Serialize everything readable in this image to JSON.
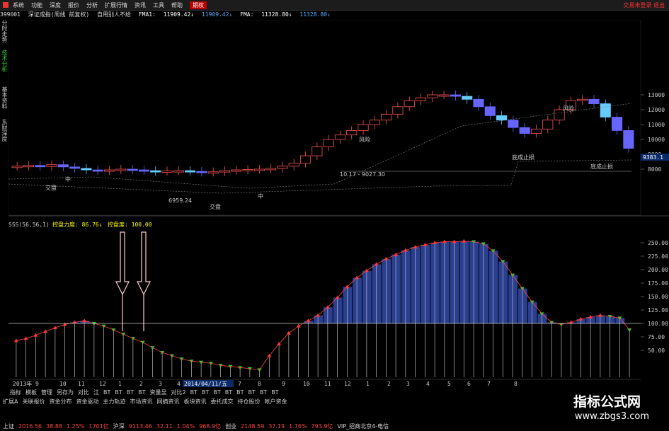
{
  "menu": {
    "items": [
      "系统",
      "功能",
      "深度",
      "报价",
      "分析",
      "扩展行情",
      "资讯",
      "工具",
      "帮助",
      "期权"
    ],
    "active_index": 9,
    "right_text": "交易未登录  退出"
  },
  "infobar": {
    "code": "399001",
    "name": "深证成指(周线 前复权)",
    "user": "自用别人不给",
    "fma1_label": "FMA1:",
    "fma1_value": "11909.42↓",
    "fma1_value2": "11909.42↓",
    "fma_label": "FMA:",
    "fma_value": "11328.80↓",
    "fma_value2": "11328.80↓"
  },
  "side_tabs": [
    "分时走势",
    "技术分析",
    "基本资料",
    "东财深度"
  ],
  "price_panel": {
    "y_ticks": [
      "13000",
      "12000",
      "11000",
      "10000",
      "9000",
      "8000"
    ],
    "current_price": "9383.1",
    "annotations": [
      "交盘",
      "交盘",
      "6959.24",
      "10.17 - 9027.30",
      "风险",
      "底成止损",
      "底成止损",
      "风险",
      "中",
      "中"
    ]
  },
  "indicator": {
    "title": "SSS(56,56,1)",
    "label1": "控盘力度: 86.76↓",
    "label2": "控盘度: 100.00",
    "y_ticks": [
      "250.00",
      "225.00",
      "200.00",
      "175.00",
      "150.00",
      "125.00",
      "100.00",
      "75.00",
      "50.00"
    ]
  },
  "x_axis": {
    "labels": [
      "2013年",
      "9",
      "10",
      "11",
      "12",
      "1",
      "2",
      "3",
      "4",
      "2014/04/11/五",
      "7",
      "8",
      "9",
      "10",
      "11",
      "12",
      "1",
      "2",
      "3",
      "4",
      "5",
      "6",
      "7",
      "8"
    ]
  },
  "toolbar": {
    "row1": [
      "指标",
      "模板",
      "管理",
      "另存为",
      "对比",
      "江",
      "BT",
      "BT",
      "BT",
      "BT",
      "资量显",
      "对比2",
      "BT",
      "BT",
      "BT",
      "BT",
      "BT",
      "BT",
      "BT",
      "BT"
    ],
    "row2": [
      "扩展A",
      "关联报价",
      "资金分布",
      "资金驱动",
      "主力轨迹",
      "市场资讯",
      "网摘资讯",
      "板块资讯",
      "委托成交",
      "持仓股份",
      "帐户资金"
    ],
    "status": [
      "上证",
      "2016.56",
      "38.88",
      "1.25%",
      "1701亿",
      "沪深",
      "9113.46",
      "32.11",
      "1.04%",
      "968.9亿",
      "创业",
      "2148.59",
      "37.19",
      "1.76%",
      "793.9亿",
      "VIP_招商北京4-电信"
    ]
  },
  "watermark": {
    "title": "指标公式网",
    "url": "www.zbgs3.com"
  },
  "chart_data": {
    "type": "bar",
    "title": "SSS(56,56,1)",
    "ylim": [
      0,
      275
    ],
    "series": [
      {
        "name": "控盘度",
        "values": [
          68,
          72,
          78,
          85,
          92,
          98,
          102,
          105,
          100,
          95,
          88,
          80,
          72,
          65,
          55,
          46,
          40,
          34,
          30,
          28,
          26,
          22,
          20,
          18,
          16,
          14,
          40,
          62,
          82,
          95,
          105,
          115,
          130,
          148,
          168,
          185,
          198,
          210,
          220,
          228,
          236,
          242,
          246,
          250,
          252,
          252,
          253,
          252,
          248,
          235,
          215,
          190,
          165,
          140,
          118,
          102,
          98,
          102,
          108,
          112,
          115,
          113,
          110,
          88
        ]
      }
    ]
  }
}
